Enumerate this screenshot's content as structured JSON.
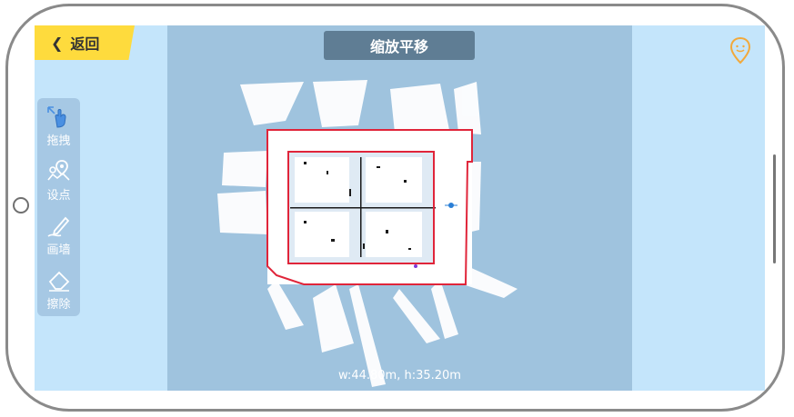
{
  "header": {
    "back_label": "返回",
    "title": "缩放平移"
  },
  "toolbar": {
    "items": [
      {
        "label": "拖拽",
        "icon": "hand-drag-icon",
        "active": true
      },
      {
        "label": "设点",
        "icon": "set-point-icon",
        "active": false
      },
      {
        "label": "画墙",
        "icon": "pen-draw-icon",
        "active": false
      },
      {
        "label": "擦除",
        "icon": "eraser-icon",
        "active": false
      }
    ]
  },
  "map": {
    "dimensions_label": "w:44.80m, h:35.20m"
  },
  "colors": {
    "accent_yellow": "#fedb3d",
    "title_bg": "#5f7d94",
    "screen_bg": "#c4e5fb",
    "map_bg": "#9fc3de",
    "wall_red": "#e0253a",
    "pin_orange": "#f2a93b"
  },
  "icons": {
    "back": "chevron-left-icon",
    "location": "location-pin-icon"
  }
}
